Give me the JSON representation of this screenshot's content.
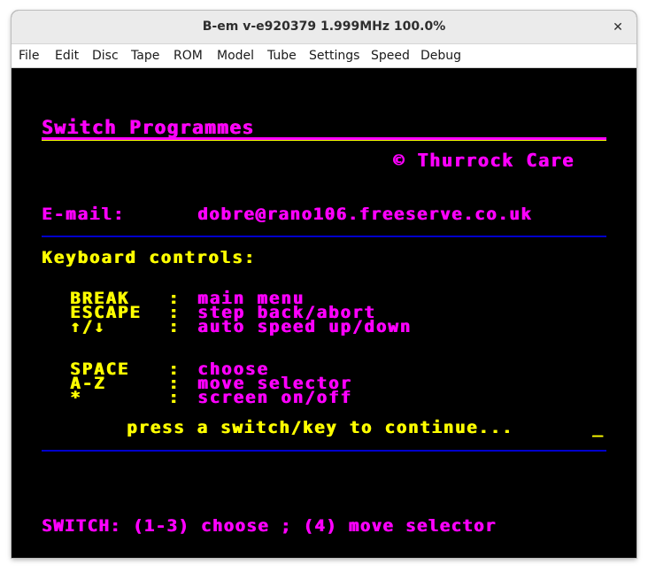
{
  "window": {
    "title": "B-em v-e920379 1.999MHz 100.0%",
    "close_glyph": "✕"
  },
  "menu": [
    "File",
    "Edit",
    "Disc",
    "Tape",
    "ROM",
    "Model",
    "Tube",
    "Settings",
    "Speed",
    "Debug"
  ],
  "screen": {
    "heading": "Switch Programmes",
    "copyright": "© Thurrock Care",
    "email_label": "E-mail:",
    "email_value": "dobre@rano106.freeserve.co.uk",
    "keyboard_heading": "Keyboard controls:",
    "controls": [
      {
        "key": "BREAK",
        "sep": ":",
        "action": "main menu"
      },
      {
        "key": "ESCAPE",
        "sep": ":",
        "action": "step back/abort"
      },
      {
        "key": "↑/↓",
        "sep": ":",
        "action": "auto speed up/down"
      },
      {
        "key": "SPACE",
        "sep": ":",
        "action": "choose"
      },
      {
        "key": "A-Z",
        "sep": ":",
        "action": "move selector"
      },
      {
        "key": "*",
        "sep": ":",
        "action": "screen on/off"
      }
    ],
    "prompt": "press a switch/key to continue...",
    "cursor": "_",
    "switch_line": "SWITCH: (1-3) choose ; (4) move selector"
  },
  "colors": {
    "magenta": "#ff00ff",
    "yellow": "#ffff00",
    "rule_blue": "#0000cc",
    "screen_bg": "#000000"
  }
}
